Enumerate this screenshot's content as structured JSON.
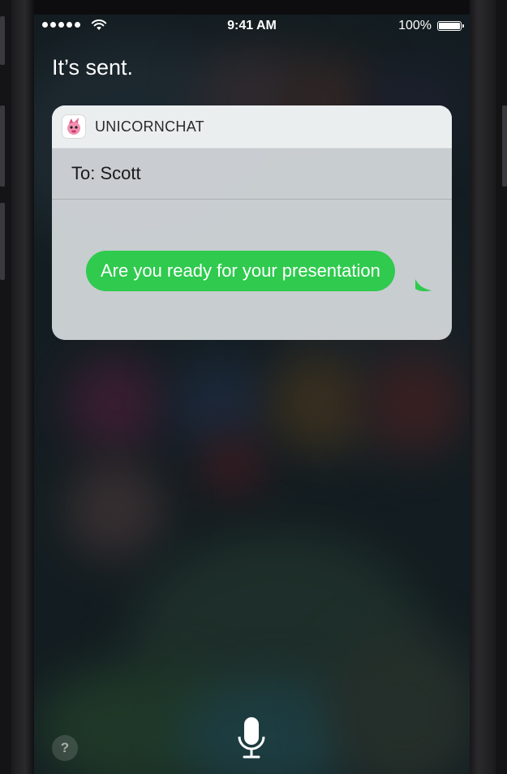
{
  "status_bar": {
    "time": "9:41 AM",
    "battery_percent": "100%",
    "signal_bars": 5,
    "wifi_icon": "wifi-icon"
  },
  "siri": {
    "response": "It’s sent."
  },
  "card": {
    "app_name": "UNICORNCHAT",
    "app_icon": "unicorn-icon",
    "recipient_line": "To: Scott",
    "message": "Are you ready for your presentation",
    "bubble_color": "#2fca4e"
  },
  "controls": {
    "help_label": "?",
    "mic_icon": "microphone-icon"
  }
}
